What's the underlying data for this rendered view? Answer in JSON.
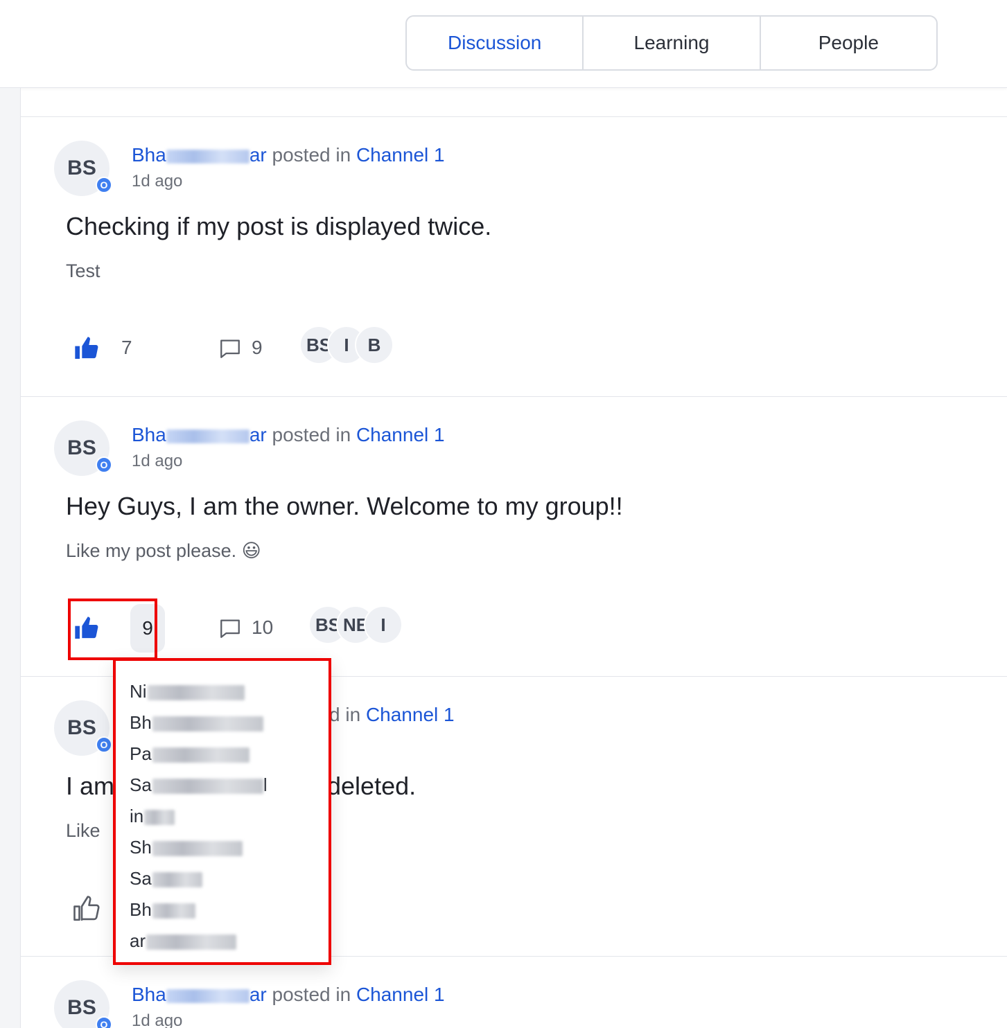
{
  "header": {
    "tabs": [
      {
        "label": "Discussion",
        "active": true
      },
      {
        "label": "Learning",
        "active": false
      },
      {
        "label": "People",
        "active": false
      }
    ]
  },
  "posts": [
    {
      "avatar_initials": "BS",
      "badge": "O",
      "author_prefix": "Bha",
      "author_suffix": "ar",
      "posted_in": "posted in",
      "channel": "Channel 1",
      "time": "1d ago",
      "title": "Checking if my post is displayed twice.",
      "body": "Test",
      "likes": "7",
      "comments": "9",
      "reactors": [
        "BS",
        "I",
        "B"
      ]
    },
    {
      "avatar_initials": "BS",
      "badge": "O",
      "author_prefix": "Bha",
      "author_suffix": "ar",
      "posted_in": "posted in",
      "channel": "Channel 1",
      "time": "1d ago",
      "title": "Hey Guys, I am the owner. Welcome to my group!!",
      "body": "Like my post please. 😃",
      "likes": "9",
      "comments": "10",
      "reactors": [
        "BS",
        "NE",
        "I"
      ]
    },
    {
      "avatar_initials": "BS",
      "badge": "O",
      "posted_in_tail": "d in",
      "channel": "Channel 1",
      "title_start": "I am",
      "title_end": "deleted.",
      "body_start": "Like"
    },
    {
      "avatar_initials": "BS",
      "badge": "O",
      "author_prefix": "Bha",
      "author_suffix": "ar",
      "posted_in": "posted in",
      "channel": "Channel 1",
      "time": "1d ago"
    }
  ],
  "likers_popover": {
    "items": [
      {
        "visible": "Ni",
        "tail": ""
      },
      {
        "visible": "Bh",
        "tail": ""
      },
      {
        "visible": "Pa",
        "tail": ""
      },
      {
        "visible": "Sa",
        "tail": "l"
      },
      {
        "visible": "in",
        "tail": ""
      },
      {
        "visible": "Sh",
        "tail": ""
      },
      {
        "visible": "Sa",
        "tail": ""
      },
      {
        "visible": "Bh",
        "tail": ""
      },
      {
        "visible": "ar",
        "tail": ""
      }
    ]
  },
  "colors": {
    "accent": "#1b55d6",
    "highlight": "#ee0000",
    "badge": "#3f7ff0"
  }
}
